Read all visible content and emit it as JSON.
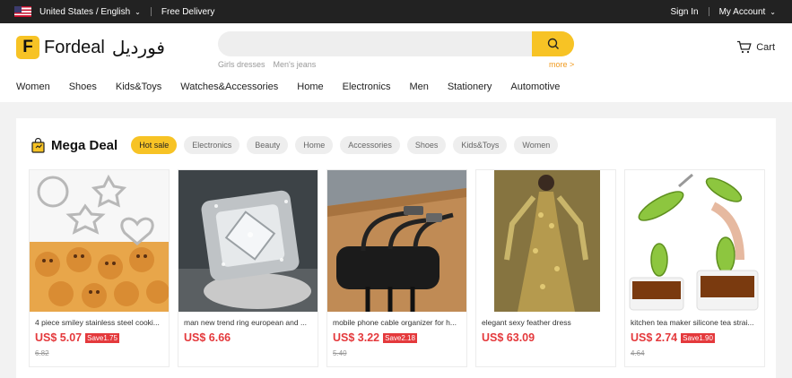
{
  "topbar": {
    "region": "United States / English",
    "free_delivery": "Free Delivery",
    "sign_in": "Sign In",
    "my_account": "My Account"
  },
  "header": {
    "logo_letter": "F",
    "logo_text": "Fordeal",
    "logo_arabic": "فورديل",
    "search_placeholder": "",
    "search_hints": [
      "Girls dresses",
      "Men's jeans"
    ],
    "more": "more >",
    "cart": "Cart"
  },
  "nav": [
    "Women",
    "Shoes",
    "Kids&Toys",
    "Watches&Accessories",
    "Home",
    "Electronics",
    "Men",
    "Stationery",
    "Automotive"
  ],
  "deal": {
    "title": "Mega Deal",
    "chips": [
      "Hot sale",
      "Electronics",
      "Beauty",
      "Home",
      "Accessories",
      "Shoes",
      "Kids&Toys",
      "Women"
    ],
    "active_chip": "Hot sale"
  },
  "products": [
    {
      "name": "4 piece smiley stainless steel cooki...",
      "price": "US$ 5.07",
      "save": "Save1.75",
      "old": "6.82"
    },
    {
      "name": "man new trend ring european and ...",
      "price": "US$ 6.66",
      "save": "",
      "old": ""
    },
    {
      "name": "mobile phone cable organizer for h...",
      "price": "US$ 3.22",
      "save": "Save2.18",
      "old": "5.40"
    },
    {
      "name": "elegant sexy feather dress",
      "price": "US$ 63.09",
      "save": "",
      "old": ""
    },
    {
      "name": "kitchen tea maker silicone tea strai...",
      "price": "US$ 2.74",
      "save": "Save1.90",
      "old": "4.64"
    }
  ],
  "colors": {
    "accent": "#f7c325",
    "price": "#e4393c",
    "topbar": "#222222"
  }
}
